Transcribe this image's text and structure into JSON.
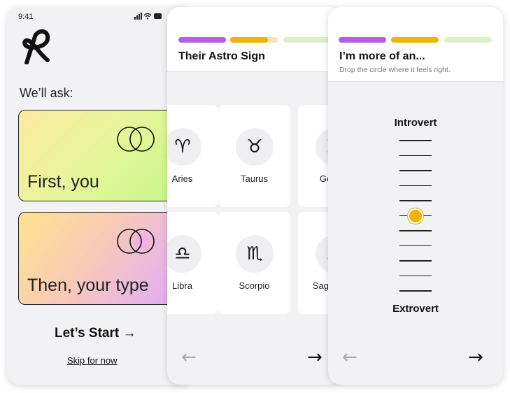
{
  "colors": {
    "accent_purple": "#b35de8",
    "accent_yellow": "#f0b400",
    "progress_pending": "#dcefc8",
    "progress_track": "#f3e3b8"
  },
  "intro": {
    "status_time": "9:41",
    "status_icons": "signal-wifi-battery-icons",
    "logo_icon": "brand-logo-icon",
    "ask_text": "We’ll ask:",
    "cards": [
      {
        "label": "First, you",
        "icon": "venn-icon"
      },
      {
        "label": "Then, your type",
        "icon": "venn-icon"
      }
    ],
    "start_label": "Let’s Start →",
    "skip_label": "Skip for now"
  },
  "astro": {
    "title": "Their Astro Sign",
    "progress": [
      {
        "state": "done",
        "color": "#b35de8"
      },
      {
        "state": "current",
        "color": "#f0b400",
        "fill": 0.7
      },
      {
        "state": "todo",
        "color": "#dcefc8"
      }
    ],
    "signs": [
      {
        "label": "Aries",
        "glyph": "♈︎",
        "icon": "aries-icon"
      },
      {
        "label": "Taurus",
        "glyph": "♉︎",
        "icon": "taurus-icon"
      },
      {
        "label": "Gemini",
        "glyph": "♊︎",
        "icon": "gemini-icon"
      },
      {
        "label": "Libra",
        "glyph": "♎︎",
        "icon": "libra-icon"
      },
      {
        "label": "Scorpio",
        "glyph": "♏︎",
        "icon": "scorpio-icon"
      },
      {
        "label": "Sagittarius",
        "glyph": "♐︎",
        "icon": "sagittarius-icon"
      }
    ],
    "back_glyph": "←",
    "next_glyph": "→"
  },
  "personality": {
    "title": "I’m more of an...",
    "subtitle": "Drop the circle where it feels right.",
    "progress": [
      {
        "state": "done",
        "color": "#b35de8"
      },
      {
        "state": "done",
        "color": "#f0b400"
      },
      {
        "state": "todo",
        "color": "#dcefc8"
      }
    ],
    "top_label": "Introvert",
    "bottom_label": "Extrovert",
    "tick_count": 11,
    "selected_index": 5,
    "back_glyph": "←",
    "next_glyph": "→"
  }
}
